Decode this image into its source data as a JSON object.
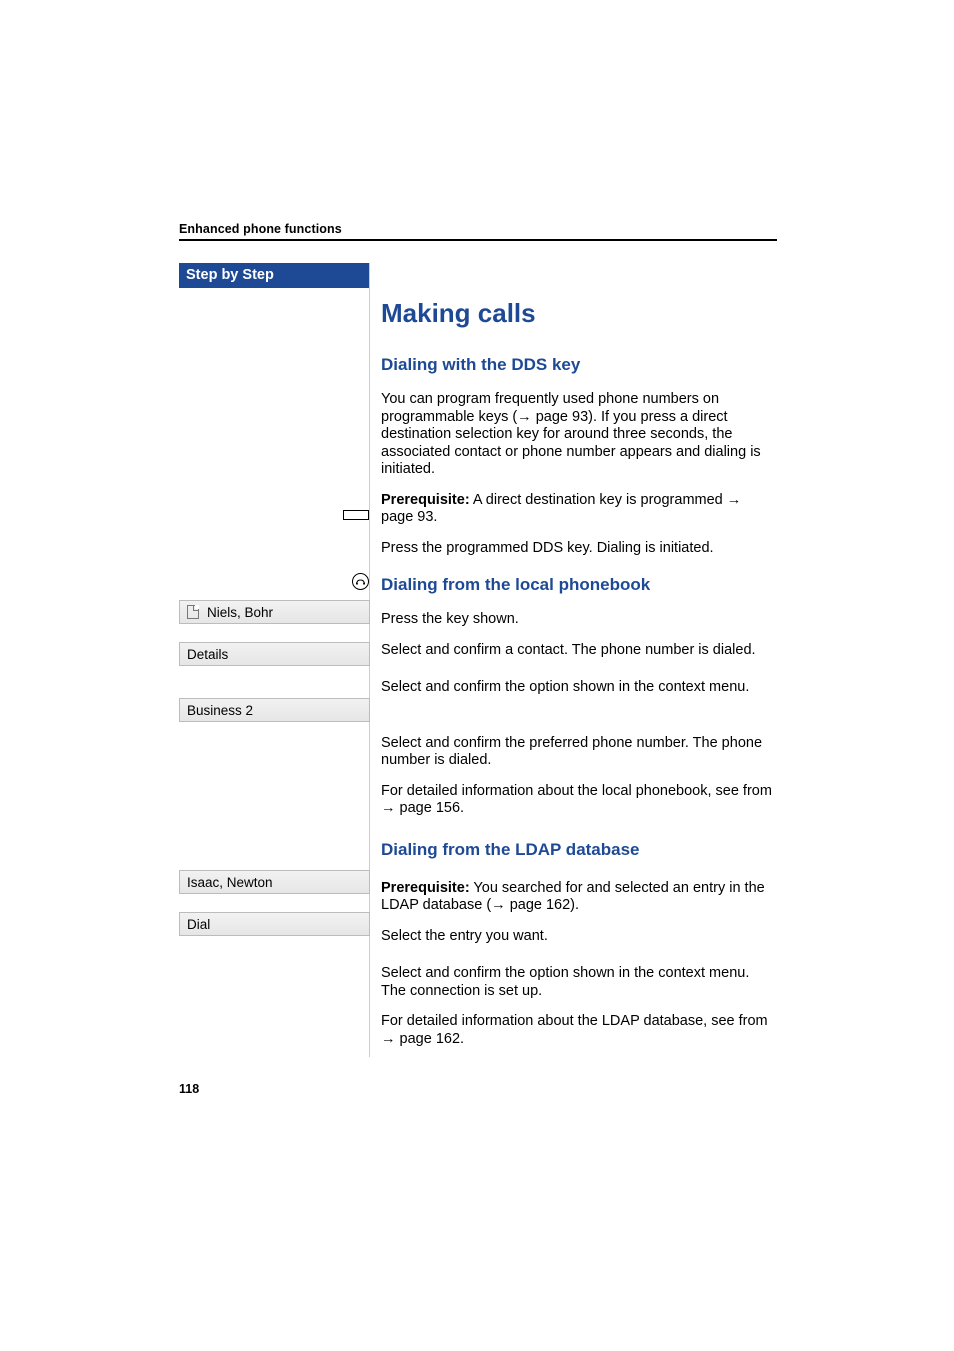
{
  "running_head": "Enhanced phone functions",
  "step_header": "Step by Step",
  "page_number": "118",
  "heading": "Making calls",
  "dds": {
    "title": "Dialing with the DDS key",
    "body": "You can program frequently used phone numbers on programmable keys (→ page 93). If you press a direct destination selection key for around three seconds, the associated contact or phone number appears and dialing is initiated.",
    "prereq_label": "Prerequisite:",
    "prereq_text": " A direct destination key is programmed → page 93.",
    "press": "Press the programmed DDS key. Dialing is initiated."
  },
  "local": {
    "title": "Dialing from the local phonebook",
    "press_key": "Press the key shown.",
    "select_contact": "Select and confirm a contact. The phone number is dialed.",
    "context": "Select and confirm the option shown in the context menu.",
    "preferred": "Select and confirm the preferred phone number. The phone number is dialed.",
    "detail_ref": "For detailed information about the local phonebook, see from → page 156."
  },
  "ldap": {
    "title": "Dialing from the LDAP database",
    "prereq_label": "Prerequisite:",
    "prereq_text": " You searched for and selected an entry in the LDAP database (→ page 162).",
    "select": "Select the entry you want.",
    "dial": "Select and confirm the option shown in the context menu. The connection is set up.",
    "detail_ref": "For detailed information about the LDAP database, see from → page 162."
  },
  "steps": {
    "contact": "Niels, Bohr",
    "details": "Details",
    "business": "Business 2",
    "ldap_contact": "Isaac, Newton",
    "dial": "Dial"
  }
}
